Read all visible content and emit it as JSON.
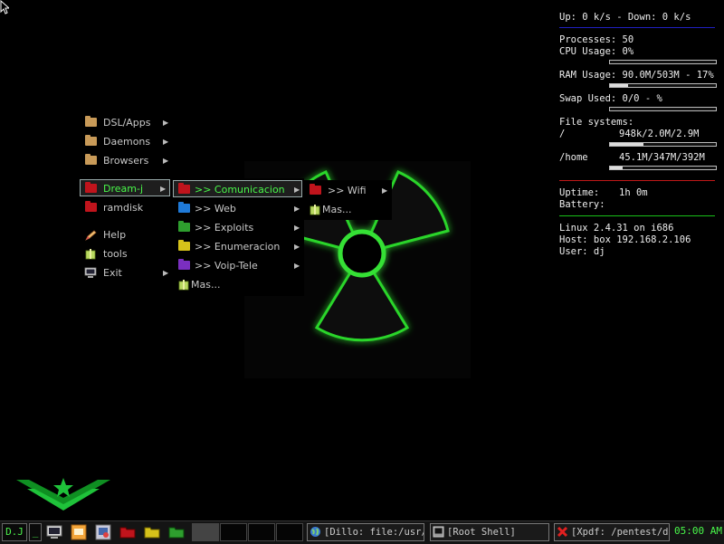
{
  "menu_main": {
    "items": [
      {
        "label": "DSL/Apps",
        "icon": "folder-icon",
        "color": "#c89a58",
        "submenu": true
      },
      {
        "label": "Daemons",
        "icon": "folder-icon",
        "color": "#c89a58",
        "submenu": true
      },
      {
        "label": "Browsers",
        "icon": "folder-icon",
        "color": "#c89a58",
        "submenu": true
      },
      {
        "label": "Dream-j",
        "icon": "folder-icon",
        "color": "#c0141c",
        "submenu": true,
        "selected": true
      },
      {
        "label": "ramdisk",
        "icon": "folder-icon",
        "color": "#c0141c",
        "submenu": false
      },
      {
        "label": "Help",
        "icon": "pencil-icon",
        "submenu": false
      },
      {
        "label": "tools",
        "icon": "package-icon",
        "submenu": false
      },
      {
        "label": "Exit",
        "icon": "monitor-icon",
        "submenu": true
      }
    ]
  },
  "menu_dreamj": {
    "items": [
      {
        "label": ">> Comunicacion",
        "icon": "folder-icon",
        "color": "#c0141c",
        "submenu": true,
        "selected": true
      },
      {
        "label": ">> Web",
        "icon": "folder-icon",
        "color": "#1f7ad8",
        "submenu": true
      },
      {
        "label": ">> Exploits",
        "icon": "folder-icon",
        "color": "#2e9e2e",
        "submenu": true
      },
      {
        "label": ">> Enumeracion",
        "icon": "folder-icon",
        "color": "#d6c21a",
        "submenu": true
      },
      {
        "label": ">> Voip-Tele",
        "icon": "folder-icon",
        "color": "#7a2fc0",
        "submenu": true
      },
      {
        "label": "Mas...",
        "icon": "package-icon",
        "submenu": false
      }
    ]
  },
  "menu_comunicacion": {
    "items": [
      {
        "label": ">> Wifi",
        "icon": "folder-icon",
        "color": "#c0141c",
        "submenu": true
      },
      {
        "label": "Mas...",
        "icon": "package-icon",
        "submenu": false
      }
    ]
  },
  "conky": {
    "net": "Up: 0 k/s - Down: 0 k/s",
    "processes": "Processes: 50",
    "cpu": "CPU Usage: 0%",
    "cpu_level": 0,
    "ram": "RAM Usage: 90.0M/503M - 17%",
    "ram_level": 0.17,
    "swap": "Swap Used: 0/0 - %",
    "swap_level": 0,
    "fs_title": "File systems:",
    "fs_root_name": "/",
    "fs_root_value": "948k/2.0M/2.9M",
    "fs_root_level": 0.32,
    "fs_home_name": "/home",
    "fs_home_value": "45.1M/347M/392M",
    "fs_home_level": 0.12,
    "uptime_label": "Uptime:",
    "uptime_value": "1h 0m",
    "battery_label": "Battery:",
    "kernel": "Linux 2.4.31 on i686",
    "host": "Host: box 192.168.2.106",
    "user": "User: dj",
    "colors": {
      "blue": "#2020c0",
      "red": "#c01818",
      "green": "#18c018"
    }
  },
  "taskbar": {
    "start_label": "D.J",
    "minimize_label": "_",
    "tasks": [
      {
        "label": "[Dillo: file:/usr/s",
        "icon": "globe-icon"
      },
      {
        "label": "[Root Shell]",
        "icon": "terminal-icon"
      },
      {
        "label": "[Xpdf: /pentest/doc",
        "icon": "xpdf-icon"
      }
    ],
    "clock": "05:00 AM",
    "accent": "#49f84a"
  }
}
